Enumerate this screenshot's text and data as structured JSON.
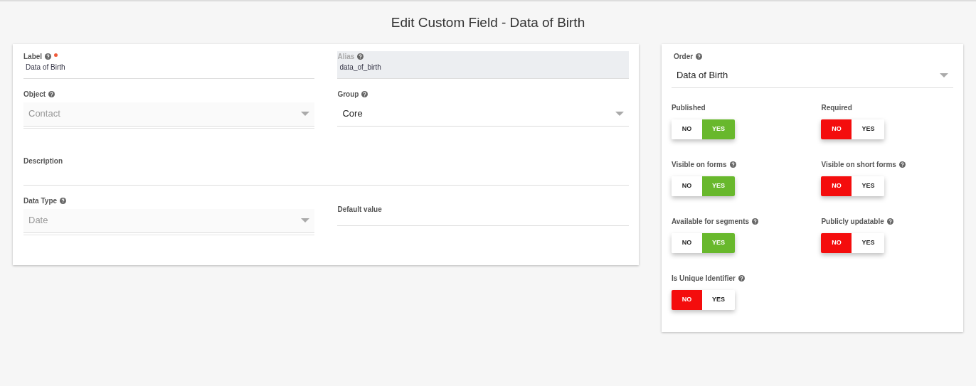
{
  "page_title": "Edit Custom Field - Data of Birth",
  "main_fields": [
    {
      "kind": "text",
      "label": "Label",
      "help": true,
      "required": true,
      "value": "Data of Birth",
      "disabled": false
    },
    {
      "kind": "text",
      "label": "Alias",
      "help": true,
      "required": false,
      "value": "data_of_birth",
      "disabled": true
    },
    {
      "kind": "select",
      "label": "Object",
      "help": true,
      "required": false,
      "value": "Contact",
      "disabled": true
    },
    {
      "kind": "select",
      "label": "Group",
      "help": true,
      "required": false,
      "value": "Core",
      "disabled": false
    },
    {
      "kind": "textarea",
      "label": "Description",
      "help": false,
      "required": false,
      "disabled": false
    },
    {
      "kind": "select",
      "label": "Data Type",
      "help": true,
      "required": false,
      "value": "Date",
      "disabled": true
    },
    {
      "kind": "inline",
      "label": "Default value",
      "help": false,
      "required": false,
      "disabled": false
    }
  ],
  "order": {
    "label": "Order",
    "help": true,
    "value": "Data of Birth"
  },
  "toggles": [
    {
      "label": "Published",
      "help": false,
      "on": true,
      "no": "NO",
      "yes": "YES"
    },
    {
      "label": "Required",
      "help": false,
      "on": false,
      "no": "NO",
      "yes": "YES"
    },
    {
      "label": "Visible on forms",
      "help": true,
      "on": true,
      "no": "NO",
      "yes": "YES"
    },
    {
      "label": "Visible on short forms",
      "help": true,
      "on": false,
      "no": "NO",
      "yes": "YES"
    },
    {
      "label": "Available for segments",
      "help": true,
      "on": true,
      "no": "NO",
      "yes": "YES"
    },
    {
      "label": "Publicly updatable",
      "help": true,
      "on": false,
      "no": "NO",
      "yes": "YES"
    },
    {
      "label": "Is Unique Identifier",
      "help": true,
      "on": false,
      "no": "NO",
      "yes": "YES"
    }
  ]
}
